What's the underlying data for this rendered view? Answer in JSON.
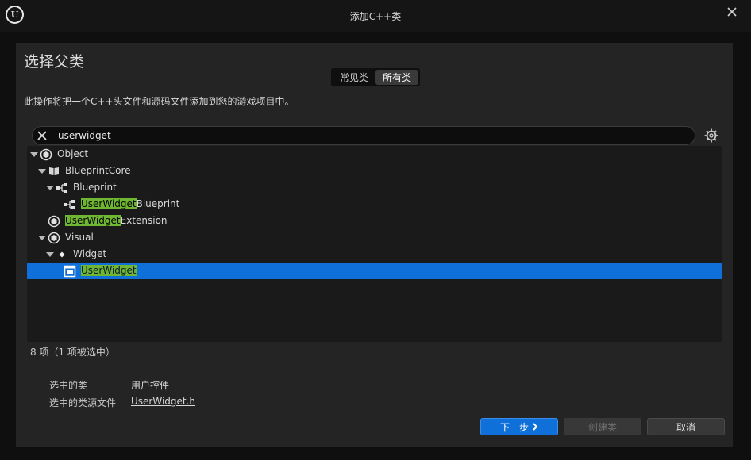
{
  "window": {
    "title": "添加C++类",
    "logo_letter": "U"
  },
  "header": {
    "heading": "选择父类"
  },
  "tabs": [
    {
      "label": "常见类",
      "active": false
    },
    {
      "label": "所有类",
      "active": true
    }
  ],
  "description": "此操作将把一个C++头文件和源码文件添加到您的游戏项目中。",
  "search": {
    "value": "userwidget"
  },
  "tree": {
    "rows": [
      {
        "pre": "",
        "match": "",
        "post": "Object",
        "icon": "class-icon"
      },
      {
        "pre": "",
        "match": "",
        "post": "BlueprintCore",
        "icon": "book-icon"
      },
      {
        "pre": "",
        "match": "",
        "post": "Blueprint",
        "icon": "hierarchy-icon"
      },
      {
        "pre": "",
        "match": "UserWidget",
        "post": "Blueprint",
        "icon": "hierarchy-icon"
      },
      {
        "pre": "",
        "match": "UserWidget",
        "post": "Extension",
        "icon": "class-icon"
      },
      {
        "pre": "",
        "match": "",
        "post": "Visual",
        "icon": "class-icon"
      },
      {
        "pre": "",
        "match": "",
        "post": "Widget",
        "icon": "diamond-icon"
      },
      {
        "pre": "",
        "match": "UserWidget",
        "post": "",
        "icon": "widget-icon",
        "selected": true
      }
    ]
  },
  "status": "8 项（1 项被选中）",
  "info": {
    "selected_class_label": "选中的类",
    "selected_class_value": "用户控件",
    "source_file_label": "选中的类源文件",
    "source_file_value": "UserWidget.h"
  },
  "buttons": {
    "next": "下一步",
    "create": "创建类",
    "cancel": "取消"
  },
  "colors": {
    "accent": "#0e70d8",
    "highlight": "#6fb632",
    "panel": "#242424"
  }
}
